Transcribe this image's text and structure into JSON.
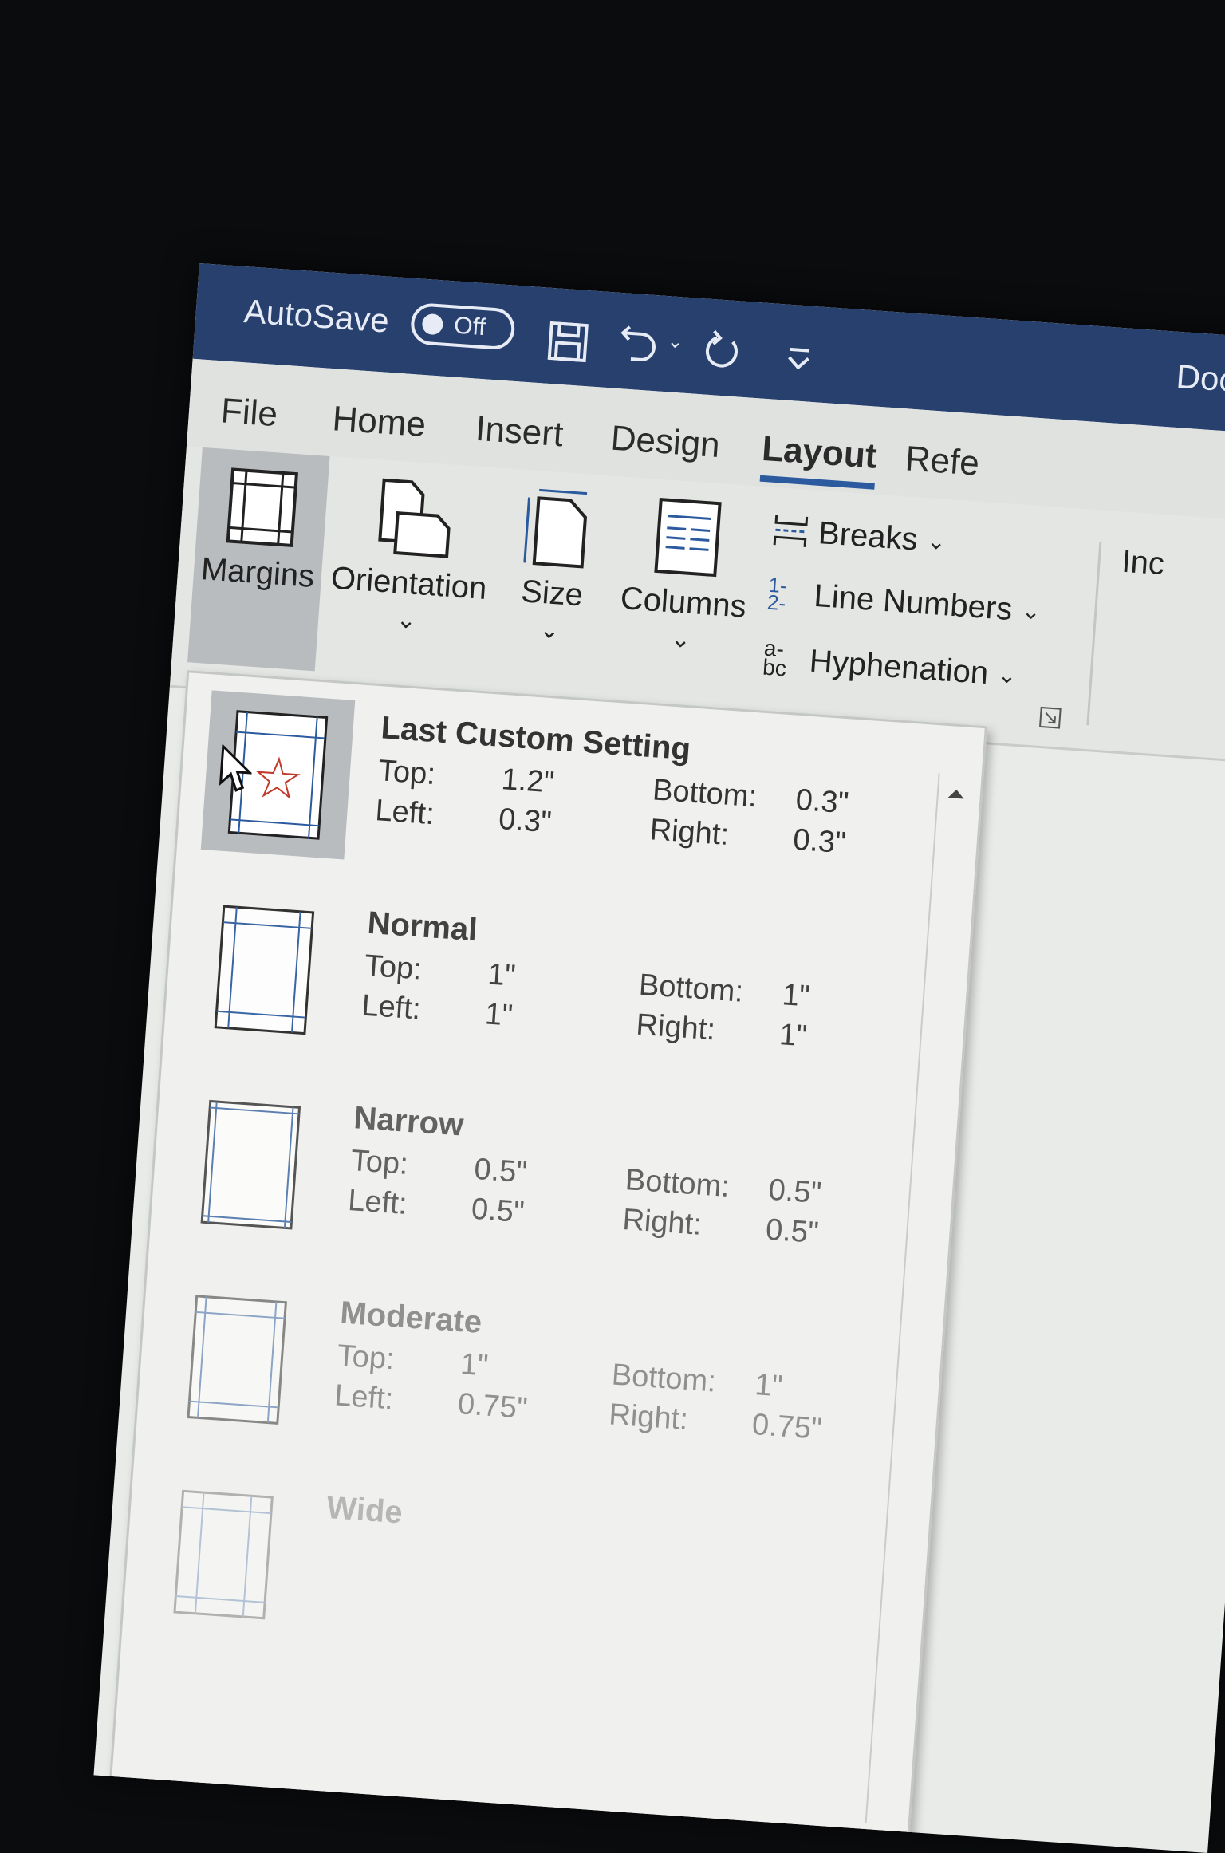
{
  "titlebar": {
    "autosave_label": "AutoSave",
    "autosave_state": "Off",
    "doc_title": "Docu"
  },
  "tabs": [
    {
      "label": "File"
    },
    {
      "label": "Home"
    },
    {
      "label": "Insert"
    },
    {
      "label": "Design"
    },
    {
      "label": "Layout",
      "active": true
    },
    {
      "label": "Refe"
    }
  ],
  "ribbon": {
    "margins": "Margins",
    "orientation": "Orientation",
    "size": "Size",
    "columns": "Columns",
    "breaks": "Breaks",
    "line_numbers": "Line Numbers",
    "hyphenation": "Hyphenation",
    "indent": "Inc"
  },
  "margins_menu": {
    "labels": {
      "top": "Top:",
      "left": "Left:",
      "bottom": "Bottom:",
      "right": "Right:"
    },
    "presets": [
      {
        "name": "Last Custom Setting",
        "top": "1.2\"",
        "left": "0.3\"",
        "bottom": "0.3\"",
        "right": "0.3\"",
        "selected": true
      },
      {
        "name": "Normal",
        "top": "1\"",
        "left": "1\"",
        "bottom": "1\"",
        "right": "1\""
      },
      {
        "name": "Narrow",
        "top": "0.5\"",
        "left": "0.5\"",
        "bottom": "0.5\"",
        "right": "0.5\""
      },
      {
        "name": "Moderate",
        "top": "1\"",
        "left": "0.75\"",
        "bottom": "1\"",
        "right": "0.75\""
      },
      {
        "name": "Wide",
        "top": "",
        "left": "",
        "bottom": "",
        "right": ""
      }
    ]
  },
  "colors": {
    "titlebar": "#27406e",
    "accent": "#2b5a9e",
    "star": "#c0392b"
  }
}
